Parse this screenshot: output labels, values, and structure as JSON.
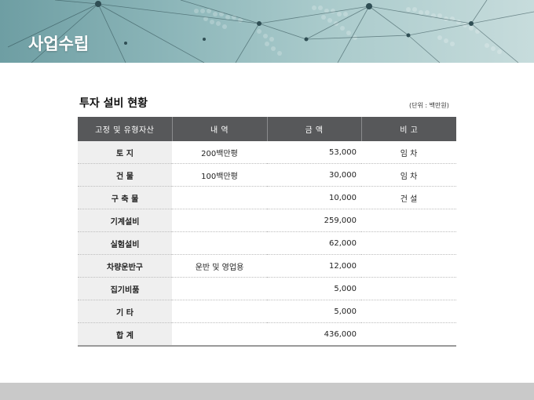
{
  "banner": {
    "title": "사업수립"
  },
  "section": {
    "title": "투자 설비 현황",
    "unit_note": "(단위 : 백만원)"
  },
  "table": {
    "headers": [
      "고정 및 유형자산",
      "내    역",
      "금    액",
      "비    고"
    ],
    "rows": [
      {
        "category": "토    지",
        "detail": "200백만평",
        "amount": "53,000",
        "note": "임  차"
      },
      {
        "category": "건    물",
        "detail": "100백만평",
        "amount": "30,000",
        "note": "임  차"
      },
      {
        "category": "구 축 물",
        "detail": "",
        "amount": "10,000",
        "note": "건  설"
      },
      {
        "category": "기계설비",
        "detail": "",
        "amount": "259,000",
        "note": ""
      },
      {
        "category": "실험설비",
        "detail": "",
        "amount": "62,000",
        "note": ""
      },
      {
        "category": "차량운반구",
        "detail": "운반 및 영업용",
        "amount": "12,000",
        "note": ""
      },
      {
        "category": "집기비품",
        "detail": "",
        "amount": "5,000",
        "note": ""
      },
      {
        "category": "기    타",
        "detail": "",
        "amount": "5,000",
        "note": ""
      },
      {
        "category": "합    계",
        "detail": "",
        "amount": "436,000",
        "note": ""
      }
    ]
  },
  "colors": {
    "banner_teal": "#8fb8bb",
    "header_gray": "#57585a",
    "category_bg": "#efefef",
    "footer_gray": "#c9c9c9"
  }
}
